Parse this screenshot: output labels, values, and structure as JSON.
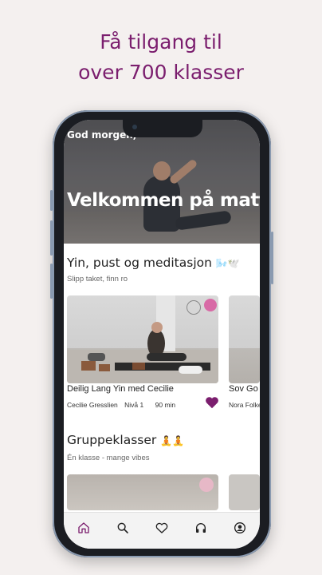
{
  "headline": {
    "line1": "Få tilgang til",
    "line2": "over 700 klasser"
  },
  "app": {
    "greeting": "God morgen,",
    "welcome": "Velkommen på matta!",
    "sections": [
      {
        "title": "Yin, pust og meditasjon",
        "emoji": "🌬️🕊️",
        "subtitle": "Slipp taket, finn ro",
        "cards": [
          {
            "title": "Deilig Lang Yin med Cecilie",
            "instructor": "Cecilie Gresslien",
            "level": "Nivå 1",
            "duration": "90 min",
            "favorited": true
          },
          {
            "title": "Sov Go",
            "instructor": "Nora Folke",
            "level": "",
            "duration": "",
            "favorited": false
          }
        ]
      },
      {
        "title": "Gruppeklasser",
        "emoji": "🧘🧘",
        "subtitle": "Én klasse - mange vibes"
      }
    ],
    "tabs": [
      {
        "icon": "home-icon",
        "active": true
      },
      {
        "icon": "search-icon",
        "active": false
      },
      {
        "icon": "heart-icon",
        "active": false
      },
      {
        "icon": "headphones-icon",
        "active": false
      },
      {
        "icon": "profile-icon",
        "active": false
      }
    ],
    "colors": {
      "accent": "#7b1e6e",
      "heart": "#7b1e6e",
      "background": "#f4f0ef"
    }
  }
}
